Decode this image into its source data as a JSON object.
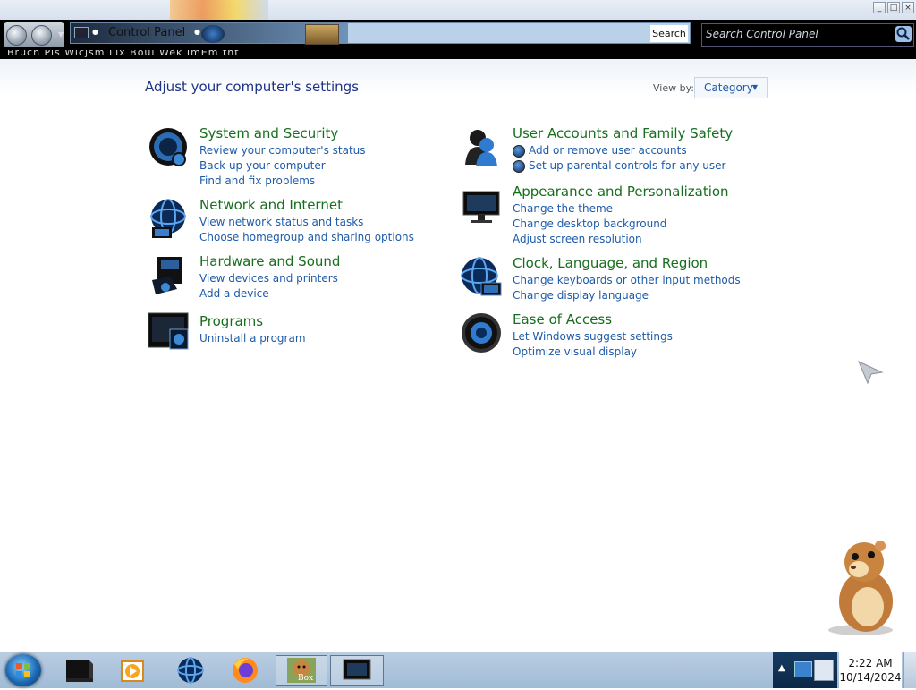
{
  "window": {
    "minimize": "_",
    "maximize": "□",
    "close": "×"
  },
  "nav": {
    "breadcrumb": "Control Panel",
    "refresh_label": "Search",
    "search_placeholder": "Search Control Panel",
    "menu_strip": "Bruch  Pis  Wicjsm  Lix  Boul  Wek  ImEm  tht"
  },
  "page": {
    "heading": "Adjust your computer's settings",
    "view_by_label": "View by:",
    "view_by_value": "Category"
  },
  "categories": [
    {
      "title": "System and Security",
      "icon": "shield-orb-icon",
      "links": [
        "Review your computer's status",
        "Back up your computer",
        "Find and fix problems"
      ]
    },
    {
      "title": "Network and Internet",
      "icon": "globe-network-icon",
      "links": [
        "View network status and tasks",
        "Choose homegroup and sharing options"
      ]
    },
    {
      "title": "Hardware and Sound",
      "icon": "printer-speaker-icon",
      "links": [
        "View devices and printers",
        "Add a device"
      ]
    },
    {
      "title": "Programs",
      "icon": "programs-monitor-icon",
      "links": [
        "Uninstall a program"
      ]
    },
    {
      "title": "User Accounts and Family Safety",
      "icon": "users-icon",
      "links": [
        "Add or remove user accounts",
        "Set up parental controls for any user"
      ]
    },
    {
      "title": "Appearance and Personalization",
      "icon": "display-icon",
      "links": [
        "Change the theme",
        "Change desktop background",
        "Adjust screen resolution"
      ]
    },
    {
      "title": "Clock, Language, and Region",
      "icon": "clock-globe-icon",
      "links": [
        "Change keyboards or other input methods",
        "Change display language"
      ]
    },
    {
      "title": "Ease of Access",
      "icon": "ease-of-access-icon",
      "links": [
        "Let Windows suggest settings",
        "Optimize visual display"
      ]
    }
  ],
  "taskbar": {
    "items": [
      "terminal-app-icon",
      "media-player-icon",
      "globe-browser-icon",
      "firefox-icon",
      "box-game-icon",
      "control-panel-window-icon"
    ],
    "box_label": "Box",
    "time": "2:22 AM",
    "date": "10/14/2024"
  }
}
